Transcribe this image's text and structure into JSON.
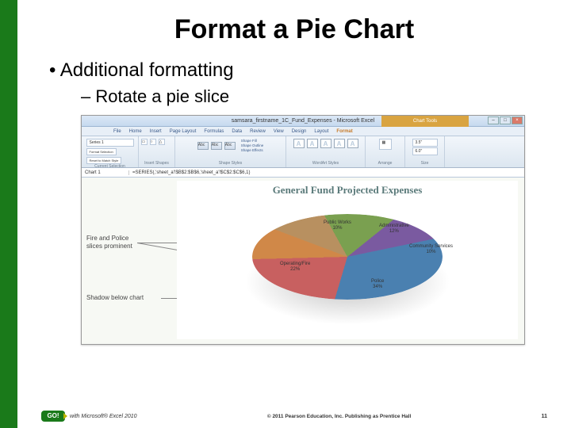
{
  "slide": {
    "title": "Format a Pie Chart",
    "bullet1": "Additional formatting",
    "bullet2": "Rotate a pie slice"
  },
  "excel": {
    "window_title": "samsara_firstname_1C_Fund_Expenses - Microsoft Excel",
    "chart_tools": "Chart Tools",
    "tabs": {
      "file": "File",
      "home": "Home",
      "insert": "Insert",
      "pagelayout": "Page Layout",
      "formulas": "Formulas",
      "data": "Data",
      "review": "Review",
      "view": "View",
      "design": "Design",
      "layout": "Layout",
      "format": "Format"
    },
    "ribbon": {
      "current_selection": "Current Selection",
      "series_label": "Series 1",
      "format_selection": "Format Selection",
      "reset": "Reset to Match Style",
      "insert_shapes": "Insert Shapes",
      "abc": "Abc",
      "shape_styles": "Shape Styles",
      "shape_fill": "Shape Fill",
      "shape_outline": "Shape Outline",
      "shape_effects": "Shape Effects",
      "wordart_styles": "WordArt Styles",
      "A": "A",
      "arrange": "Arrange",
      "size": "Size"
    },
    "formula": {
      "name": "Chart 1",
      "content": "=SERIES(,'sheet_a'!$B$2:$B$6,'sheet_a'!$C$2:$C$6,1)"
    },
    "chart_title": "General Fund Projected Expenses"
  },
  "chart_data": {
    "type": "pie",
    "title": "General Fund Projected Expenses",
    "series": [
      {
        "name": "Public Works",
        "value": 10,
        "label": "Public Works\n10%",
        "color": "#b89060"
      },
      {
        "name": "Administrative",
        "value": 12,
        "label": "Administrative\n12%",
        "color": "#7aa050"
      },
      {
        "name": "Community Services",
        "value": 10,
        "label": "Community Services\n10%",
        "color": "#7a5aa0"
      },
      {
        "name": "Police",
        "value": 34,
        "label": "Police\n34%",
        "color": "#4a80b0"
      },
      {
        "name": "Operating/Fire",
        "value": 22,
        "label": "Operating/Fire\n22%",
        "color": "#c86060"
      },
      {
        "name": "Fire",
        "value": 12,
        "label": "",
        "color": "#d08848"
      }
    ]
  },
  "callouts": {
    "slices": "Fire and Police\nslices prominent",
    "shadow": "Shadow below chart"
  },
  "footer": {
    "logo": "GO!",
    "left": "with Microsoft® Excel 2010",
    "center": "© 2011 Pearson Education, Inc. Publishing as Prentice Hall",
    "page": "11"
  }
}
